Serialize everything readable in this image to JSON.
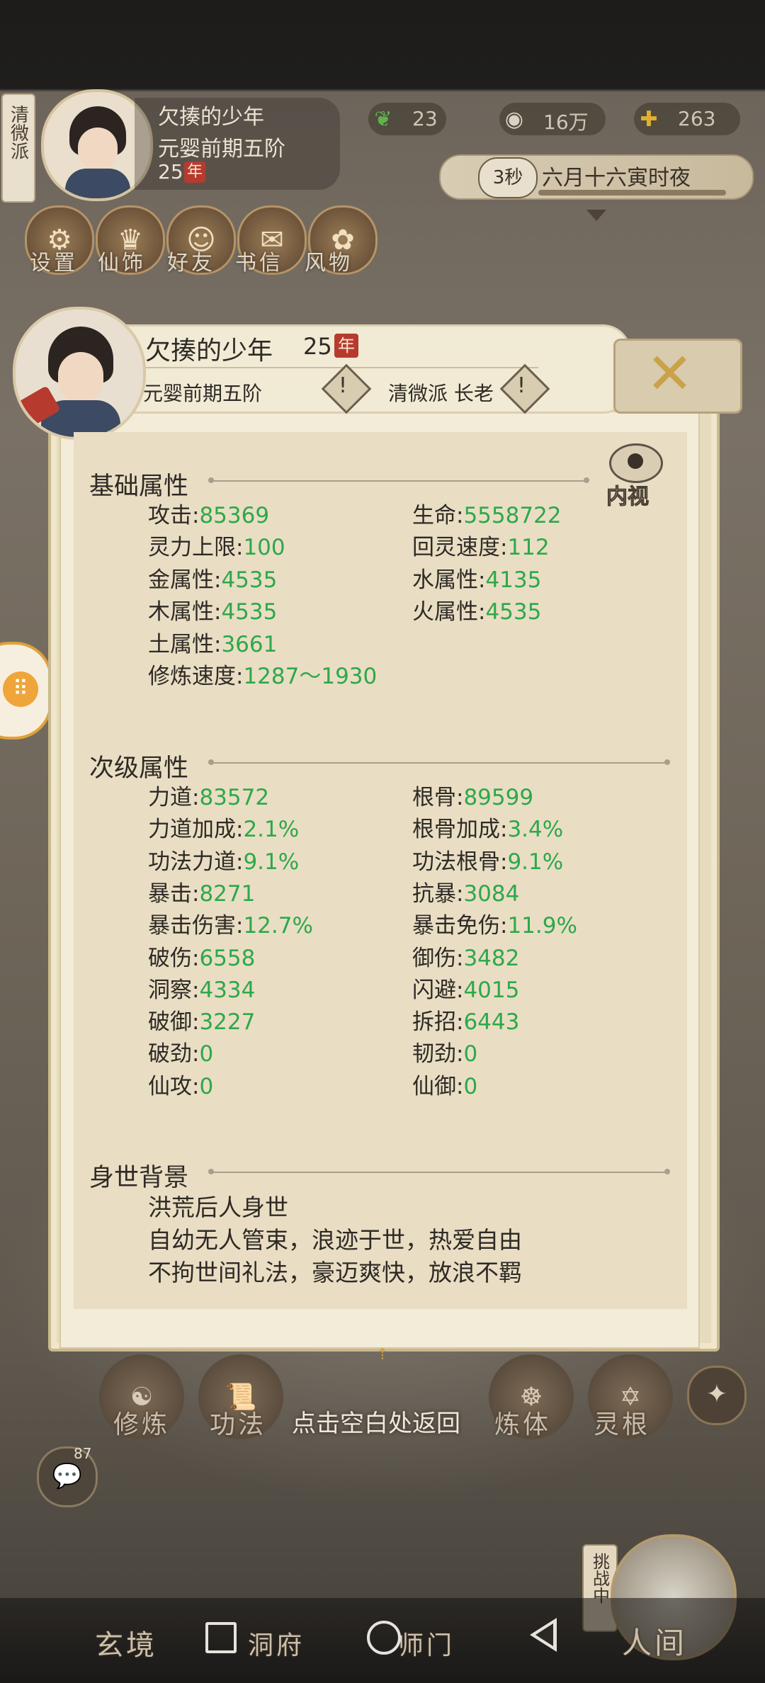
{
  "hud": {
    "sect_vertical": "清微派",
    "player_name": "欠揍的少年",
    "realm": "元婴前期五阶",
    "age": "25",
    "age_unit": "年",
    "resources": [
      {
        "icon": "leaf-icon",
        "value": "23"
      },
      {
        "icon": "coin-icon",
        "value": "16万"
      },
      {
        "icon": "spirit-stone-icon",
        "value": "263"
      }
    ],
    "timer": "3秒",
    "date_text": "六月十六寅时夜",
    "quick_buttons": [
      {
        "icon": "gear-icon",
        "label": "设置"
      },
      {
        "icon": "costume-icon",
        "label": "仙饰"
      },
      {
        "icon": "friends-icon",
        "label": "好友"
      },
      {
        "icon": "letter-icon",
        "label": "书信"
      },
      {
        "icon": "scenery-icon",
        "label": "风物"
      }
    ]
  },
  "profile": {
    "name": "欠揍的少年",
    "age": "25",
    "age_unit": "年",
    "realm": "元婴前期五阶",
    "sect_role": "清微派 长老",
    "inner_view_label": "内视"
  },
  "basic": {
    "title": "基础属性",
    "rows": [
      {
        "left": {
          "label": "攻击:",
          "value": "85369"
        },
        "right": {
          "label": "生命:",
          "value": "5558722"
        }
      },
      {
        "left": {
          "label": "灵力上限:",
          "value": "100"
        },
        "right": {
          "label": "回灵速度:",
          "value": "112"
        }
      },
      {
        "left": {
          "label": "金属性:",
          "value": "4535"
        },
        "right": {
          "label": "水属性:",
          "value": "4135"
        }
      },
      {
        "left": {
          "label": "木属性:",
          "value": "4535"
        },
        "right": {
          "label": "火属性:",
          "value": "4535"
        }
      },
      {
        "left": {
          "label": "土属性:",
          "value": "3661"
        }
      },
      {
        "left": {
          "label": "修炼速度:",
          "value": "1287～1930"
        }
      }
    ]
  },
  "secondary": {
    "title": "次级属性",
    "rows": [
      {
        "left": {
          "label": "力道:",
          "value": "83572"
        },
        "right": {
          "label": "根骨:",
          "value": "89599"
        }
      },
      {
        "left": {
          "label": "力道加成:",
          "value": "2.1%"
        },
        "right": {
          "label": "根骨加成:",
          "value": "3.4%"
        }
      },
      {
        "left": {
          "label": "功法力道:",
          "value": "9.1%"
        },
        "right": {
          "label": "功法根骨:",
          "value": "9.1%"
        }
      },
      {
        "left": {
          "label": "暴击:",
          "value": "8271"
        },
        "right": {
          "label": "抗暴:",
          "value": "3084"
        }
      },
      {
        "left": {
          "label": "暴击伤害:",
          "value": "12.7%"
        },
        "right": {
          "label": "暴击免伤:",
          "value": "11.9%"
        }
      },
      {
        "left": {
          "label": "破伤:",
          "value": "6558"
        },
        "right": {
          "label": "御伤:",
          "value": "3482"
        }
      },
      {
        "left": {
          "label": "洞察:",
          "value": "4334"
        },
        "right": {
          "label": "闪避:",
          "value": "4015"
        }
      },
      {
        "left": {
          "label": "破御:",
          "value": "3227"
        },
        "right": {
          "label": "拆招:",
          "value": "6443"
        }
      },
      {
        "left": {
          "label": "破劲:",
          "value": "0"
        },
        "right": {
          "label": "韧劲:",
          "value": "0"
        }
      },
      {
        "left": {
          "label": "仙攻:",
          "value": "0"
        },
        "right": {
          "label": "仙御:",
          "value": "0"
        }
      }
    ]
  },
  "background": {
    "title": "身世背景",
    "lines": [
      "洪荒后人身世",
      "自幼无人管束，浪迹于世，热爱自由",
      "不拘世间礼法，豪迈爽快，放浪不羁"
    ]
  },
  "bottom": {
    "tap_hint": "点击空白处返回",
    "action_buttons": [
      "修炼",
      "功法",
      "炼体",
      "灵根"
    ],
    "chat_badge": "87",
    "challenge_label": "挑战中",
    "nav": [
      "玄境",
      "洞府",
      "师门",
      "人间"
    ]
  },
  "colors": {
    "stat_value": "#2ea84a",
    "paper": "#e9dec4",
    "accent": "#c9a24a"
  }
}
